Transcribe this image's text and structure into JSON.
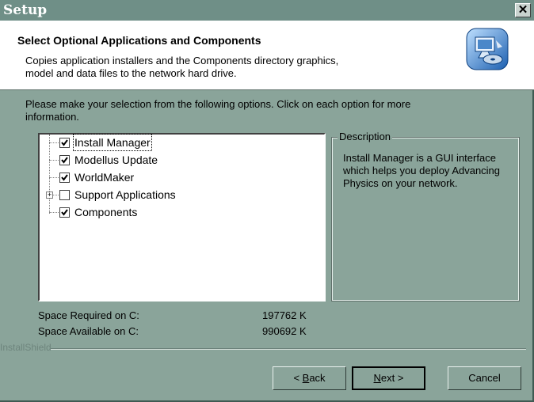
{
  "window": {
    "title": "Setup",
    "close_glyph": "✕"
  },
  "header": {
    "title": "Select Optional Applications and Components",
    "description_line1": "Copies application installers and the Components directory graphics,",
    "description_line2": "model and data files to the network hard drive.",
    "icon": "computer-install-icon"
  },
  "instructions_line1": "Please make your selection from the following options. Click on each option for more",
  "instructions_line2": "information.",
  "tree": {
    "items": [
      {
        "label": "Install Manager",
        "checked": true,
        "selected": true
      },
      {
        "label": "Modellus Update",
        "checked": true,
        "selected": false
      },
      {
        "label": "WorldMaker",
        "checked": true,
        "selected": false
      },
      {
        "label": "Support Applications",
        "checked": false,
        "selected": false,
        "expandable": true
      },
      {
        "label": "Components",
        "checked": true,
        "selected": false
      }
    ]
  },
  "description": {
    "legend": "Description",
    "text": "Install Manager is a GUI interface which helps you deploy Advancing Physics on your network."
  },
  "space": {
    "required_label": "Space Required on  C:",
    "required_value": "197762 K",
    "available_label": "Space Available on  C:",
    "available_value": "990692 K"
  },
  "brand": "InstallShield",
  "buttons": {
    "back_prefix": "< ",
    "back_key": "B",
    "back_rest": "ack",
    "next_key": "N",
    "next_rest": "ext >",
    "cancel": "Cancel"
  },
  "colors": {
    "dialog": "#8aa49a",
    "titlebar": "#6f8f87",
    "header": "#ffffff"
  }
}
